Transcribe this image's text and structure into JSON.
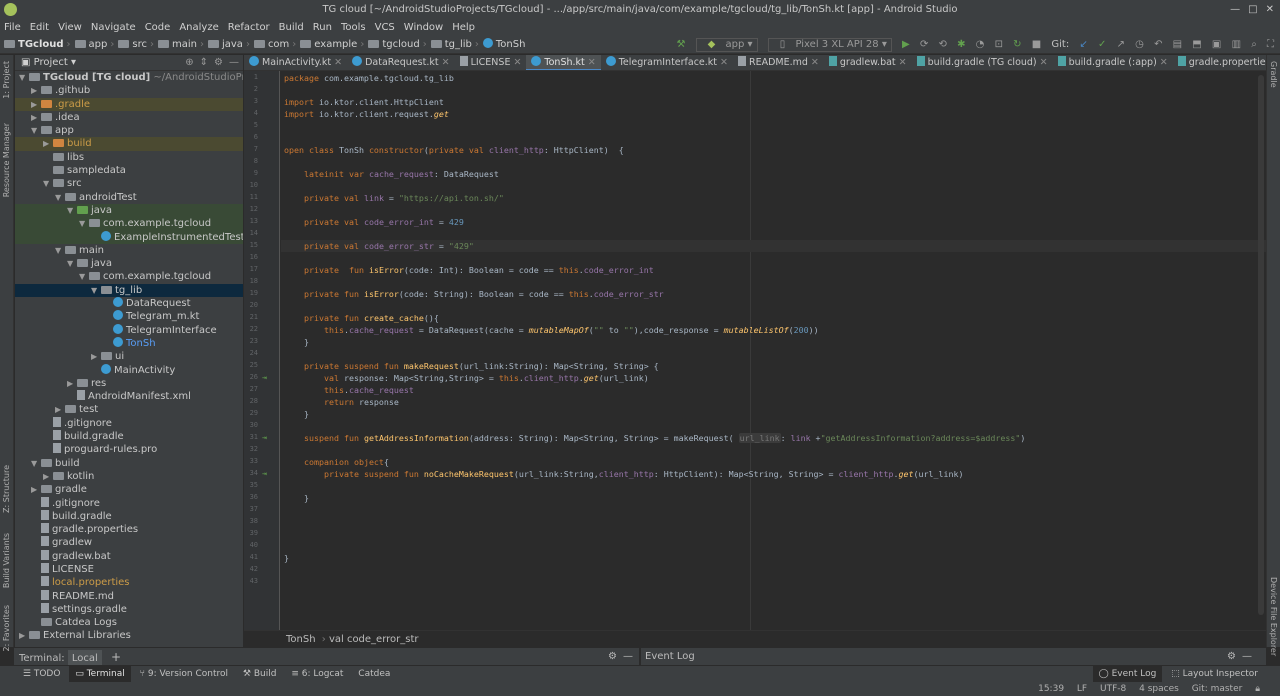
{
  "window": {
    "title": "TG cloud [~/AndroidStudioProjects/TGcloud] - .../app/src/main/java/com/example/tgcloud/tg_lib/TonSh.kt [app] - Android Studio"
  },
  "menu": [
    "File",
    "Edit",
    "View",
    "Navigate",
    "Code",
    "Analyze",
    "Refactor",
    "Build",
    "Run",
    "Tools",
    "VCS",
    "Window",
    "Help"
  ],
  "breadcrumbs": [
    "TGcloud",
    "app",
    "src",
    "main",
    "java",
    "com",
    "example",
    "tgcloud",
    "tg_lib",
    "TonSh"
  ],
  "toolbar": {
    "run_config": "app",
    "device": "Pixel 3 XL API 28",
    "git_label": "Git:"
  },
  "project_panel": {
    "title": "Project"
  },
  "tree": [
    {
      "indent": 0,
      "arrow": "▼",
      "icon": "folder",
      "label": "TGcloud [TG cloud]",
      "extra": " ~/AndroidStudioProjects/TGcloud",
      "bold": true
    },
    {
      "indent": 1,
      "arrow": "▶",
      "icon": "folder",
      "label": ".github"
    },
    {
      "indent": 1,
      "arrow": "▶",
      "icon": "folder-orange",
      "label": ".gradle",
      "style": "olive"
    },
    {
      "indent": 1,
      "arrow": "▶",
      "icon": "folder",
      "label": ".idea"
    },
    {
      "indent": 1,
      "arrow": "▼",
      "icon": "folder",
      "label": "app"
    },
    {
      "indent": 2,
      "arrow": "▶",
      "icon": "folder-orange",
      "label": "build",
      "style": "olive"
    },
    {
      "indent": 2,
      "arrow": "",
      "icon": "folder",
      "label": "libs"
    },
    {
      "indent": 2,
      "arrow": "",
      "icon": "folder",
      "label": "sampledata"
    },
    {
      "indent": 2,
      "arrow": "▼",
      "icon": "folder",
      "label": "src"
    },
    {
      "indent": 3,
      "arrow": "▼",
      "icon": "folder",
      "label": "androidTest"
    },
    {
      "indent": 4,
      "arrow": "▼",
      "icon": "folder-green",
      "label": "java",
      "style": "green"
    },
    {
      "indent": 5,
      "arrow": "▼",
      "icon": "folder",
      "label": "com.example.tgcloud",
      "style": "green"
    },
    {
      "indent": 6,
      "arrow": "",
      "icon": "kt",
      "label": "ExampleInstrumentedTest",
      "style": "green"
    },
    {
      "indent": 3,
      "arrow": "▼",
      "icon": "folder",
      "label": "main"
    },
    {
      "indent": 4,
      "arrow": "▼",
      "icon": "folder",
      "label": "java"
    },
    {
      "indent": 5,
      "arrow": "▼",
      "icon": "folder",
      "label": "com.example.tgcloud"
    },
    {
      "indent": 6,
      "arrow": "▼",
      "icon": "folder",
      "label": "tg_lib",
      "style": "sel"
    },
    {
      "indent": 7,
      "arrow": "",
      "icon": "kt",
      "label": "DataRequest"
    },
    {
      "indent": 7,
      "arrow": "",
      "icon": "kt",
      "label": "Telegram_m.kt"
    },
    {
      "indent": 7,
      "arrow": "",
      "icon": "kt",
      "label": "TelegramInterface"
    },
    {
      "indent": 7,
      "arrow": "",
      "icon": "kt",
      "label": "TonSh",
      "color": "blue"
    },
    {
      "indent": 6,
      "arrow": "▶",
      "icon": "folder",
      "label": "ui"
    },
    {
      "indent": 6,
      "arrow": "",
      "icon": "kt",
      "label": "MainActivity"
    },
    {
      "indent": 4,
      "arrow": "▶",
      "icon": "folder",
      "label": "res"
    },
    {
      "indent": 4,
      "arrow": "",
      "icon": "file",
      "label": "AndroidManifest.xml"
    },
    {
      "indent": 3,
      "arrow": "▶",
      "icon": "folder",
      "label": "test"
    },
    {
      "indent": 2,
      "arrow": "",
      "icon": "file",
      "label": ".gitignore"
    },
    {
      "indent": 2,
      "arrow": "",
      "icon": "file",
      "label": "build.gradle"
    },
    {
      "indent": 2,
      "arrow": "",
      "icon": "file",
      "label": "proguard-rules.pro"
    },
    {
      "indent": 1,
      "arrow": "▼",
      "icon": "folder",
      "label": "build"
    },
    {
      "indent": 2,
      "arrow": "▶",
      "icon": "folder",
      "label": "kotlin"
    },
    {
      "indent": 1,
      "arrow": "▶",
      "icon": "folder",
      "label": "gradle"
    },
    {
      "indent": 1,
      "arrow": "",
      "icon": "file",
      "label": ".gitignore"
    },
    {
      "indent": 1,
      "arrow": "",
      "icon": "file",
      "label": "build.gradle"
    },
    {
      "indent": 1,
      "arrow": "",
      "icon": "file",
      "label": "gradle.properties"
    },
    {
      "indent": 1,
      "arrow": "",
      "icon": "file",
      "label": "gradlew"
    },
    {
      "indent": 1,
      "arrow": "",
      "icon": "file",
      "label": "gradlew.bat"
    },
    {
      "indent": 1,
      "arrow": "",
      "icon": "file",
      "label": "LICENSE"
    },
    {
      "indent": 1,
      "arrow": "",
      "icon": "file",
      "label": "local.properties",
      "color": "orange"
    },
    {
      "indent": 1,
      "arrow": "",
      "icon": "file",
      "label": "README.md"
    },
    {
      "indent": 1,
      "arrow": "",
      "icon": "file",
      "label": "settings.gradle"
    },
    {
      "indent": 1,
      "arrow": "",
      "icon": "folder",
      "label": "Catdea Logs"
    },
    {
      "indent": 0,
      "arrow": "▶",
      "icon": "folder",
      "label": "External Libraries"
    }
  ],
  "tabs": [
    {
      "label": "MainActivity.kt"
    },
    {
      "label": "DataRequest.kt"
    },
    {
      "label": "LICENSE"
    },
    {
      "label": "TonSh.kt",
      "active": true
    },
    {
      "label": "TelegramInterface.kt"
    },
    {
      "label": "README.md"
    },
    {
      "label": "gradlew.bat"
    },
    {
      "label": "build.gradle (TG cloud)"
    },
    {
      "label": "build.gradle (:app)"
    },
    {
      "label": "gradle.properties"
    }
  ],
  "editor": {
    "line_count": 43,
    "current_line": 15,
    "run_gutter_lines": [
      26,
      31,
      34
    ],
    "lines": {
      "1": "package com.example.tgcloud.tg_lib",
      "3": "import io.ktor.client.HttpClient",
      "4": "import io.ktor.client.request.get",
      "7": "open class TonSh constructor(private val client_http: HttpClient)  {",
      "9": "    lateinit var cache_request: DataRequest",
      "11": "    private val link = \"https://api.ton.sh/\"",
      "13": "    private val code_error_int = 429",
      "15": "    private val code_error_str = \"429\"",
      "17": "    private  fun isError(code: Int): Boolean = code == this.code_error_int",
      "19": "    private fun isError(code: String): Boolean = code == this.code_error_str",
      "21": "    private fun create_cache(){",
      "22": "        this.cache_request = DataRequest(cache = mutableMapOf(\"\" to \"\"),code_response = mutableListOf(200))",
      "23": "    }",
      "25": "    private suspend fun makeRequest(url_link:String): Map<String, String> {",
      "26": "        val response: Map<String,String> = this.client_http.get(url_link)",
      "27": "        this.cache_request",
      "28": "        return response",
      "29": "    }",
      "31": "    suspend fun getAddressInformation(address: String): Map<String, String> = makeRequest( url_link: link +\"getAddressInformation?address=$address\")",
      "33": "    companion object{",
      "34": "        private suspend fun noCacheMakeRequest(url_link:String,client_http: HttpClient): Map<String, String> = client_http.get(url_link)",
      "36": "    }",
      "41": "}"
    }
  },
  "bottom": {
    "breadcrumb": [
      "TonSh",
      "val code_error_str"
    ],
    "terminal_label": "Terminal:",
    "terminal_tab": "Local",
    "event_log_title": "Event Log",
    "tools": [
      "TODO",
      "Terminal",
      "9: Version Control",
      "Build",
      "6: Logcat",
      "Catdea"
    ],
    "right_tools": [
      "Event Log",
      "Layout Inspector"
    ]
  },
  "status": {
    "position": "15:39",
    "line_sep": "LF",
    "encoding": "UTF-8",
    "indent": "4 spaces",
    "vcs": "Git: master"
  },
  "side_labels": {
    "left": [
      "1: Project",
      "Resource Manager",
      "Z: Structure",
      "Build Variants",
      "2: Favorites"
    ],
    "right": [
      "Gradle",
      "Device File Explorer"
    ]
  }
}
